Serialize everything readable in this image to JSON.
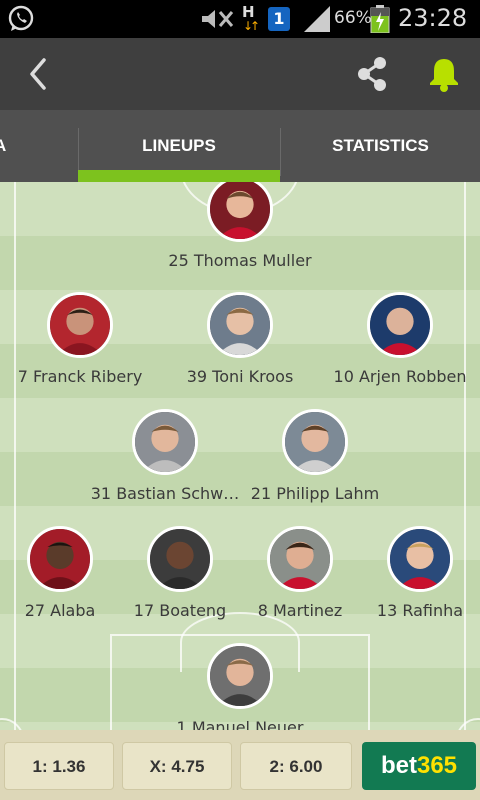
{
  "status_bar": {
    "network_type": "H",
    "sim_badge": "1",
    "battery_percent": "66%",
    "time": "23:28",
    "icons": [
      "whatsapp-icon",
      "mute-icon",
      "data-arrows-icon",
      "signal-icon",
      "battery-charging-icon"
    ]
  },
  "app_bar": {
    "icons": [
      "back-arrow-icon",
      "share-icon",
      "bell-icon"
    ],
    "accent_color": "#b8e000"
  },
  "tabs": {
    "items": [
      {
        "label": "A"
      },
      {
        "label": "LINEUPS",
        "selected": true
      },
      {
        "label": "STATISTICS"
      }
    ],
    "indicator_color": "#7dc21e"
  },
  "lineup": {
    "players": [
      {
        "label": "25 Thomas Muller"
      },
      {
        "label": "7 Franck Ribery"
      },
      {
        "label": "39 Toni Kroos"
      },
      {
        "label": "10 Arjen Robben"
      },
      {
        "label": "31 Bastian Schw…"
      },
      {
        "label": "21 Philipp Lahm"
      },
      {
        "label": "27 Alaba"
      },
      {
        "label": "17 Boateng"
      },
      {
        "label": "8 Martinez"
      },
      {
        "label": "13 Rafinha"
      },
      {
        "label": "1 Manuel Neuer"
      }
    ]
  },
  "odds": {
    "home": "1: 1.36",
    "draw": "X: 4.75",
    "away": "2: 6.00",
    "brand_main": "bet",
    "brand_accent": "365",
    "brand_color": "#127a52"
  }
}
